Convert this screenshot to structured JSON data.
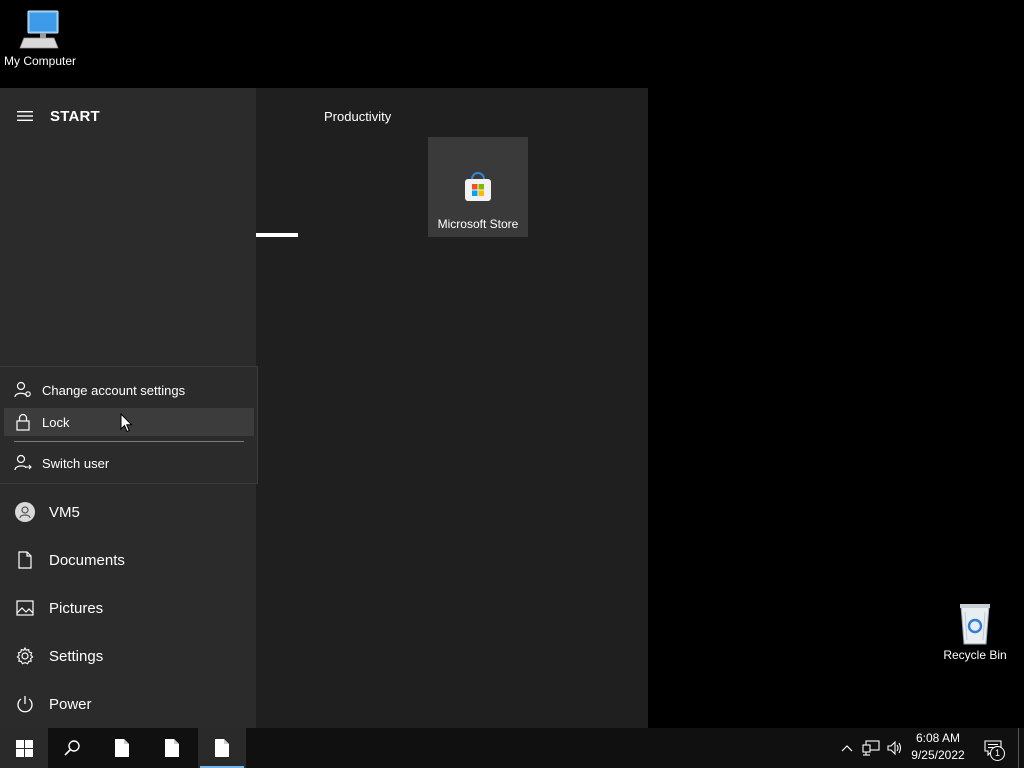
{
  "desktop": {
    "icons": [
      {
        "label": "My Computer",
        "icon": "computer-icon"
      },
      {
        "label": "Recycle Bin",
        "icon": "recycle-bin-icon"
      }
    ]
  },
  "start_menu": {
    "title": "START",
    "account_flyout": {
      "items": [
        {
          "label": "Change account settings",
          "icon": "account-settings-icon"
        },
        {
          "label": "Lock",
          "icon": "lock-icon",
          "hovered": true
        },
        {
          "label": "Switch user",
          "icon": "switch-user-icon"
        }
      ]
    },
    "nav": [
      {
        "label": "VM5",
        "icon": "user-avatar-icon"
      },
      {
        "label": "Documents",
        "icon": "document-icon"
      },
      {
        "label": "Pictures",
        "icon": "pictures-icon"
      },
      {
        "label": "Settings",
        "icon": "gear-icon"
      },
      {
        "label": "Power",
        "icon": "power-icon"
      }
    ],
    "tiles": {
      "group_label": "Productivity",
      "items": [
        {
          "label": "Microsoft Store",
          "icon": "microsoft-store-icon"
        }
      ]
    }
  },
  "taskbar": {
    "buttons": [
      {
        "name": "start",
        "icon": "windows-logo-icon"
      },
      {
        "name": "search",
        "icon": "search-icon"
      },
      {
        "name": "app1",
        "icon": "file-icon"
      },
      {
        "name": "app2",
        "icon": "file-icon"
      },
      {
        "name": "app3",
        "icon": "file-icon",
        "active": true
      }
    ],
    "tray": {
      "time": "6:08 AM",
      "date": "9/25/2022",
      "notification_count": "1"
    }
  },
  "colors": {
    "start_left_bg": "#2b2b2b",
    "start_right_bg": "#1f1f1f",
    "taskbar_bg": "#101010",
    "accent": "#76b9ed"
  }
}
